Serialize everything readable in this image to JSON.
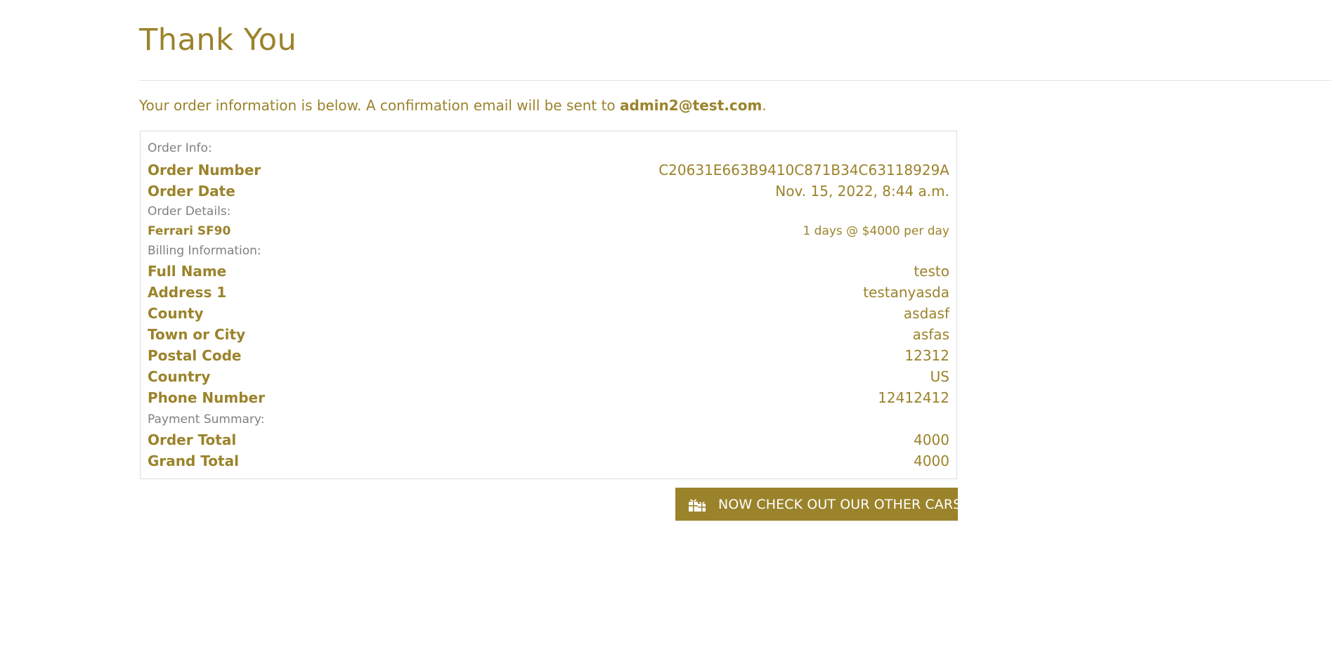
{
  "page": {
    "title": "Thank You",
    "intro_text": "Your order information is below. A confirmation email will be sent to ",
    "email": "admin2@test.com",
    "intro_end": "."
  },
  "order_info": {
    "section_label": "Order Info:",
    "order_number_label": "Order Number",
    "order_number": "C20631E663B9410C871B34C63118929A",
    "order_date_label": "Order Date",
    "order_date": "Nov. 15, 2022, 8:44 a.m."
  },
  "order_details": {
    "section_label": "Order Details:",
    "items": [
      {
        "name": "Ferrari SF90",
        "detail": "1 days @ $4000 per day"
      }
    ]
  },
  "billing": {
    "section_label": "Billing Information:",
    "full_name_label": "Full Name",
    "full_name": "testo",
    "address1_label": "Address 1",
    "address1": "testanyasda",
    "county_label": "County",
    "county": "asdasf",
    "town_label": "Town or City",
    "town": "asfas",
    "postal_label": "Postal Code",
    "postal": "12312",
    "country_label": "Country",
    "country": "US",
    "phone_label": "Phone Number",
    "phone": "12412412"
  },
  "payment": {
    "section_label": "Payment Summary:",
    "order_total_label": "Order Total",
    "order_total": "4000",
    "grand_total_label": "Grand Total",
    "grand_total": "4000"
  },
  "cta": {
    "label": "NOW CHECK OUT OUR OTHER CARS!",
    "icon": "gift-boxes-icon"
  },
  "colors": {
    "accent": "#9b832b",
    "muted": "#808080",
    "border": "#dcdcdc"
  }
}
